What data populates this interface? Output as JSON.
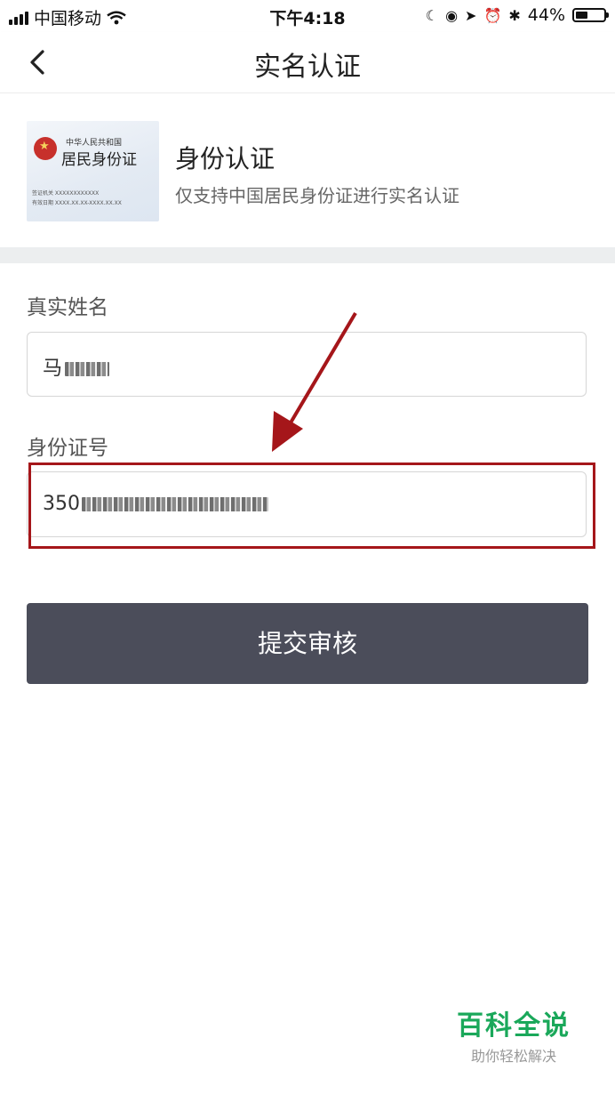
{
  "status_bar": {
    "carrier": "中国移动",
    "time": "下午4:18",
    "battery_percent": "44%",
    "battery_level": 0.44,
    "icons": [
      "signal-icon",
      "wifi-icon",
      "moon-icon",
      "orientation-lock-icon",
      "location-icon",
      "alarm-icon",
      "bluetooth-icon",
      "battery-icon"
    ]
  },
  "nav": {
    "title": "实名认证",
    "back_icon": "chevron-left-icon"
  },
  "id_card": {
    "image": {
      "small_title": "中华人民共和国",
      "big_title": "居民身份证",
      "line1": "签证机关  XXXXXXXXXXXX",
      "line2": "有效日期  XXXX.XX.XX-XXXX.XX.XX"
    },
    "title": "身份认证",
    "subtitle": "仅支持中国居民身份证进行实名认证"
  },
  "form": {
    "name_label": "真实姓名",
    "name_value": "马",
    "id_label": "身份证号",
    "id_value": "350"
  },
  "submit_label": "提交审核",
  "watermark": {
    "title": "百科全说",
    "subtitle": "助你轻松解决"
  },
  "colors": {
    "button": "#4b4d5a",
    "highlight": "#a5161a",
    "watermark": "#1aa85a",
    "section_gap": "#eceeef"
  }
}
